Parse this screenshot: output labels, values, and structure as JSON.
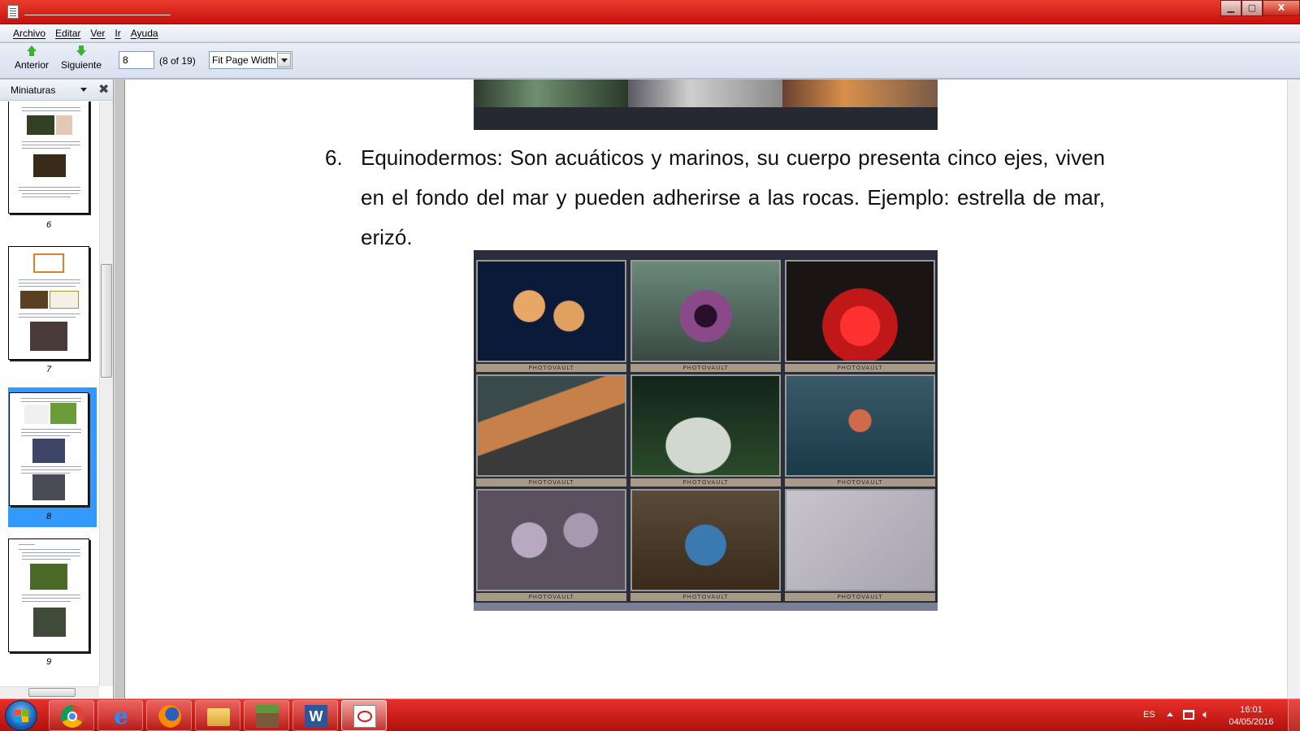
{
  "window": {
    "minimize": "▁",
    "maximize": "▢",
    "close": "X"
  },
  "menu": [
    "Archivo",
    "Editar",
    "Ver",
    "Ir",
    "Ayuda"
  ],
  "toolbar": {
    "prev_label": "Anterior",
    "next_label": "Siguiente",
    "page_value": "8",
    "page_count": "(8 of 19)",
    "zoom_value": "Fit Page Width"
  },
  "sidebar": {
    "title": "Miniaturas",
    "close_icon": "✖",
    "thumbnails": [
      {
        "label": "6"
      },
      {
        "label": "7"
      },
      {
        "label": "8",
        "selected": true
      },
      {
        "label": "9"
      }
    ]
  },
  "document": {
    "item_number": "6.",
    "item_text": "Equinodermos: Son acuáticos y marinos, su cuerpo presenta cinco ejes, viven en el fondo del mar y pueden adherirse a las rocas. Ejemplo: estrella de mar, erizó.",
    "photo_caption": "PHOTOVAULT"
  },
  "taskbar": {
    "apps": [
      "chrome-icon",
      "internet-explorer-icon",
      "firefox-icon",
      "file-explorer-icon",
      "minecraft-icon",
      "word-icon",
      "pdf-reader-icon"
    ],
    "language": "ES",
    "time": "16:01",
    "date": "04/05/2016"
  },
  "colors": {
    "title_bar": "#d81c14",
    "taskbar": "#c8140e",
    "selection": "#3399ff",
    "nav_arrow": "#3bb12f"
  }
}
